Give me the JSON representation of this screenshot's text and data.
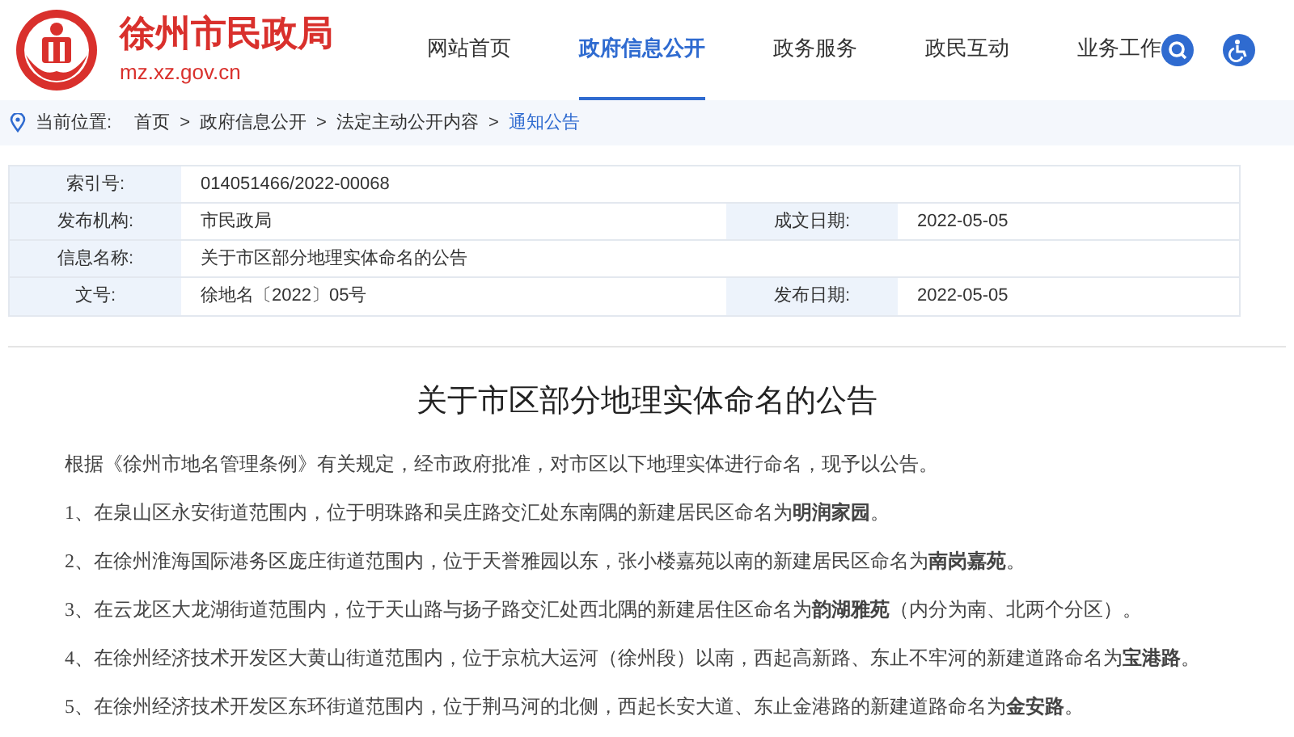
{
  "header": {
    "site_name": "徐州市民政局",
    "domain": "mz.xz.gov.cn",
    "nav": [
      {
        "label": "网站首页",
        "selected": false
      },
      {
        "label": "政府信息公开",
        "selected": true
      },
      {
        "label": "政务服务",
        "selected": false
      },
      {
        "label": "政民互动",
        "selected": false
      },
      {
        "label": "业务工作",
        "selected": false
      }
    ]
  },
  "breadcrumb": {
    "label": "当前位置:",
    "separator": ">",
    "items": [
      {
        "label": "首页",
        "selected": false
      },
      {
        "label": "政府信息公开",
        "selected": false
      },
      {
        "label": "法定主动公开内容",
        "selected": false
      },
      {
        "label": "通知公告",
        "selected": true
      }
    ]
  },
  "info_table": {
    "rows": [
      [
        {
          "label": "索引号:",
          "value": "014051466/2022-00068"
        }
      ],
      [
        {
          "label": "发布机构:",
          "value": "市民政局"
        },
        {
          "label": "成文日期:",
          "value": "2022-05-05"
        }
      ],
      [
        {
          "label": "信息名称:",
          "value": "关于市区部分地理实体命名的公告"
        }
      ],
      [
        {
          "label": "文号:",
          "value": "徐地名〔2022〕05号"
        },
        {
          "label": "发布日期:",
          "value": "2022-05-05"
        }
      ]
    ]
  },
  "article": {
    "title": "关于市区部分地理实体命名的公告",
    "paragraphs": [
      "根据《徐州市地名管理条例》有关规定，经市政府批准，对市区以下地理实体进行命名，现予以公告。",
      "1、在泉山区永安街道范围内，位于明珠路和吴庄路交汇处东南隅的新建居民区命名为**明润家园**。",
      "2、在徐州淮海国际港务区庞庄街道范围内，位于天誉雅园以东，张小楼嘉苑以南的新建居民区命名为**南岗嘉苑**。",
      "3、在云龙区大龙湖街道范围内，位于天山路与扬子路交汇处西北隅的新建居住区命名为**韵湖雅苑**（内分为南、北两个分区）。",
      "4、在徐州经济技术开发区大黄山街道范围内，位于京杭大运河（徐州段）以南，西起高新路、东止不牢河的新建道路命名为**宝港路**。",
      "5、在徐州经济技术开发区东环街道范围内，位于荆马河的北侧，西起长安大道、东止金港路的新建道路命名为**金安路**。"
    ]
  }
}
